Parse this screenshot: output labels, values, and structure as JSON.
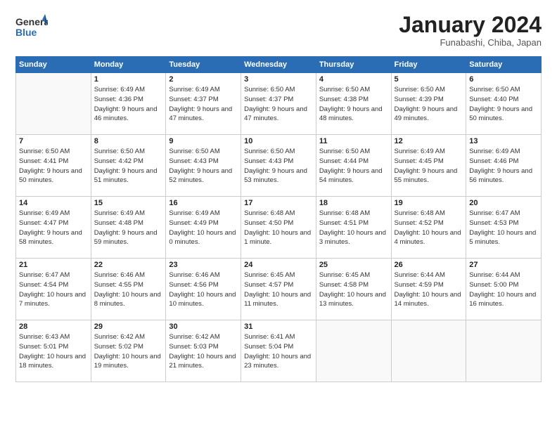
{
  "header": {
    "logo_general": "General",
    "logo_blue": "Blue",
    "month_title": "January 2024",
    "subtitle": "Funabashi, Chiba, Japan"
  },
  "weekdays": [
    "Sunday",
    "Monday",
    "Tuesday",
    "Wednesday",
    "Thursday",
    "Friday",
    "Saturday"
  ],
  "weeks": [
    [
      {
        "day": "",
        "sunrise": "",
        "sunset": "",
        "daylight": ""
      },
      {
        "day": "1",
        "sunrise": "Sunrise: 6:49 AM",
        "sunset": "Sunset: 4:36 PM",
        "daylight": "Daylight: 9 hours and 46 minutes."
      },
      {
        "day": "2",
        "sunrise": "Sunrise: 6:49 AM",
        "sunset": "Sunset: 4:37 PM",
        "daylight": "Daylight: 9 hours and 47 minutes."
      },
      {
        "day": "3",
        "sunrise": "Sunrise: 6:50 AM",
        "sunset": "Sunset: 4:37 PM",
        "daylight": "Daylight: 9 hours and 47 minutes."
      },
      {
        "day": "4",
        "sunrise": "Sunrise: 6:50 AM",
        "sunset": "Sunset: 4:38 PM",
        "daylight": "Daylight: 9 hours and 48 minutes."
      },
      {
        "day": "5",
        "sunrise": "Sunrise: 6:50 AM",
        "sunset": "Sunset: 4:39 PM",
        "daylight": "Daylight: 9 hours and 49 minutes."
      },
      {
        "day": "6",
        "sunrise": "Sunrise: 6:50 AM",
        "sunset": "Sunset: 4:40 PM",
        "daylight": "Daylight: 9 hours and 50 minutes."
      }
    ],
    [
      {
        "day": "7",
        "sunrise": "Sunrise: 6:50 AM",
        "sunset": "Sunset: 4:41 PM",
        "daylight": "Daylight: 9 hours and 50 minutes."
      },
      {
        "day": "8",
        "sunrise": "Sunrise: 6:50 AM",
        "sunset": "Sunset: 4:42 PM",
        "daylight": "Daylight: 9 hours and 51 minutes."
      },
      {
        "day": "9",
        "sunrise": "Sunrise: 6:50 AM",
        "sunset": "Sunset: 4:43 PM",
        "daylight": "Daylight: 9 hours and 52 minutes."
      },
      {
        "day": "10",
        "sunrise": "Sunrise: 6:50 AM",
        "sunset": "Sunset: 4:43 PM",
        "daylight": "Daylight: 9 hours and 53 minutes."
      },
      {
        "day": "11",
        "sunrise": "Sunrise: 6:50 AM",
        "sunset": "Sunset: 4:44 PM",
        "daylight": "Daylight: 9 hours and 54 minutes."
      },
      {
        "day": "12",
        "sunrise": "Sunrise: 6:49 AM",
        "sunset": "Sunset: 4:45 PM",
        "daylight": "Daylight: 9 hours and 55 minutes."
      },
      {
        "day": "13",
        "sunrise": "Sunrise: 6:49 AM",
        "sunset": "Sunset: 4:46 PM",
        "daylight": "Daylight: 9 hours and 56 minutes."
      }
    ],
    [
      {
        "day": "14",
        "sunrise": "Sunrise: 6:49 AM",
        "sunset": "Sunset: 4:47 PM",
        "daylight": "Daylight: 9 hours and 58 minutes."
      },
      {
        "day": "15",
        "sunrise": "Sunrise: 6:49 AM",
        "sunset": "Sunset: 4:48 PM",
        "daylight": "Daylight: 9 hours and 59 minutes."
      },
      {
        "day": "16",
        "sunrise": "Sunrise: 6:49 AM",
        "sunset": "Sunset: 4:49 PM",
        "daylight": "Daylight: 10 hours and 0 minutes."
      },
      {
        "day": "17",
        "sunrise": "Sunrise: 6:48 AM",
        "sunset": "Sunset: 4:50 PM",
        "daylight": "Daylight: 10 hours and 1 minute."
      },
      {
        "day": "18",
        "sunrise": "Sunrise: 6:48 AM",
        "sunset": "Sunset: 4:51 PM",
        "daylight": "Daylight: 10 hours and 3 minutes."
      },
      {
        "day": "19",
        "sunrise": "Sunrise: 6:48 AM",
        "sunset": "Sunset: 4:52 PM",
        "daylight": "Daylight: 10 hours and 4 minutes."
      },
      {
        "day": "20",
        "sunrise": "Sunrise: 6:47 AM",
        "sunset": "Sunset: 4:53 PM",
        "daylight": "Daylight: 10 hours and 5 minutes."
      }
    ],
    [
      {
        "day": "21",
        "sunrise": "Sunrise: 6:47 AM",
        "sunset": "Sunset: 4:54 PM",
        "daylight": "Daylight: 10 hours and 7 minutes."
      },
      {
        "day": "22",
        "sunrise": "Sunrise: 6:46 AM",
        "sunset": "Sunset: 4:55 PM",
        "daylight": "Daylight: 10 hours and 8 minutes."
      },
      {
        "day": "23",
        "sunrise": "Sunrise: 6:46 AM",
        "sunset": "Sunset: 4:56 PM",
        "daylight": "Daylight: 10 hours and 10 minutes."
      },
      {
        "day": "24",
        "sunrise": "Sunrise: 6:45 AM",
        "sunset": "Sunset: 4:57 PM",
        "daylight": "Daylight: 10 hours and 11 minutes."
      },
      {
        "day": "25",
        "sunrise": "Sunrise: 6:45 AM",
        "sunset": "Sunset: 4:58 PM",
        "daylight": "Daylight: 10 hours and 13 minutes."
      },
      {
        "day": "26",
        "sunrise": "Sunrise: 6:44 AM",
        "sunset": "Sunset: 4:59 PM",
        "daylight": "Daylight: 10 hours and 14 minutes."
      },
      {
        "day": "27",
        "sunrise": "Sunrise: 6:44 AM",
        "sunset": "Sunset: 5:00 PM",
        "daylight": "Daylight: 10 hours and 16 minutes."
      }
    ],
    [
      {
        "day": "28",
        "sunrise": "Sunrise: 6:43 AM",
        "sunset": "Sunset: 5:01 PM",
        "daylight": "Daylight: 10 hours and 18 minutes."
      },
      {
        "day": "29",
        "sunrise": "Sunrise: 6:42 AM",
        "sunset": "Sunset: 5:02 PM",
        "daylight": "Daylight: 10 hours and 19 minutes."
      },
      {
        "day": "30",
        "sunrise": "Sunrise: 6:42 AM",
        "sunset": "Sunset: 5:03 PM",
        "daylight": "Daylight: 10 hours and 21 minutes."
      },
      {
        "day": "31",
        "sunrise": "Sunrise: 6:41 AM",
        "sunset": "Sunset: 5:04 PM",
        "daylight": "Daylight: 10 hours and 23 minutes."
      },
      {
        "day": "",
        "sunrise": "",
        "sunset": "",
        "daylight": ""
      },
      {
        "day": "",
        "sunrise": "",
        "sunset": "",
        "daylight": ""
      },
      {
        "day": "",
        "sunrise": "",
        "sunset": "",
        "daylight": ""
      }
    ]
  ]
}
